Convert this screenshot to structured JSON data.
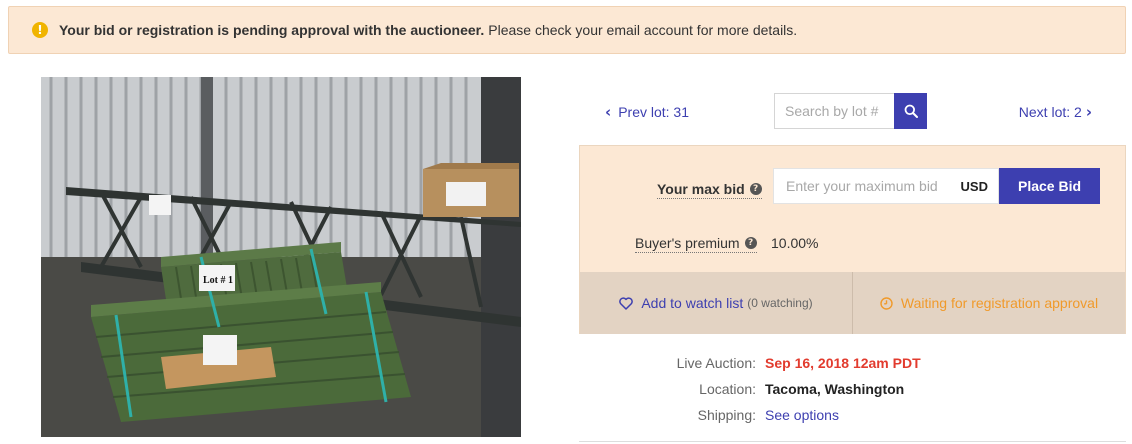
{
  "alert": {
    "bold_text": "Your bid or registration is pending approval with the auctioneer.",
    "text": "Please check your email account for more details.",
    "icon": "exclamation-circle-icon"
  },
  "photo": {
    "alt": "Pallet racking uprights and beams on pallets in a warehouse",
    "sign_text": "Lot # 1"
  },
  "nav": {
    "prev_label": "Prev lot: 31",
    "next_label": "Next lot: 2",
    "search_placeholder": "Search by lot #"
  },
  "bid": {
    "max_bid_label": "Your max bid",
    "input_placeholder": "Enter your maximum bid",
    "currency": "USD",
    "place_bid_label": "Place Bid",
    "premium_label": "Buyer's premium",
    "premium_value": "10.00%"
  },
  "actions": {
    "watch_label": "Add to watch list",
    "watch_count": "(0 watching)",
    "waiting_label": "Waiting for registration approval"
  },
  "details": {
    "live_auction_label": "Live Auction:",
    "live_auction_value": "Sep 16, 2018 12am PDT",
    "location_label": "Location:",
    "location_value": "Tacoma, Washington",
    "shipping_label": "Shipping:",
    "shipping_value": "See options"
  },
  "colors": {
    "accent": "#3d3fb0",
    "panel_bg": "#fce8d4",
    "warning": "#f09a2b",
    "date_red": "#e23b2e"
  }
}
